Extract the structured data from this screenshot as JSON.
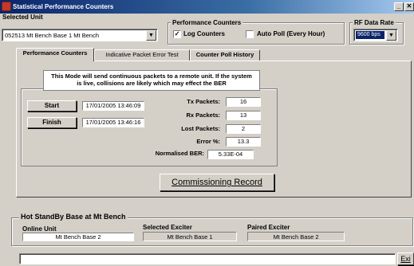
{
  "window": {
    "title": "Statistical Performance Counters",
    "minimize_glyph": "_",
    "close_glyph": "✕"
  },
  "selected_unit": {
    "label": "Selected Unit",
    "value": "052513 Mt Bench Base 1 Mt Bench",
    "arrow": "▼"
  },
  "performance_counters": {
    "label": "Performance Counters",
    "log_counters": {
      "label": "Log Counters",
      "checked": true,
      "mark": "✓"
    },
    "auto_poll": {
      "label": "Auto Poll  (Every Hour)",
      "checked": false,
      "mark": ""
    }
  },
  "rf_data_rate": {
    "label": "RF Data Rate",
    "value": "9600 bps",
    "arrow": "▼"
  },
  "tabs": [
    {
      "label": "Performance Counters",
      "active": true
    },
    {
      "label": "Indicative Packet Error Test",
      "active": false
    },
    {
      "label": "Counter Poll History",
      "active": false
    }
  ],
  "warning_text": "This Mode will send continuous packets to a remote unit. If the system is live, collisions are likely which may effect the BER",
  "start": {
    "label": "Start",
    "time": "17/01/2005  13:46:09"
  },
  "finish": {
    "label": "Finish",
    "time": "17/01/2005  13:46:16"
  },
  "stats": {
    "tx": {
      "label": "Tx Packets:",
      "value": "16"
    },
    "rx": {
      "label": "Rx Packets:",
      "value": "13"
    },
    "lost": {
      "label": "Lost Packets:",
      "value": "2"
    },
    "error": {
      "label": "Error %:",
      "value": "13.3"
    },
    "ber": {
      "label": "Normalised BER:",
      "value": "5.33E-04"
    }
  },
  "commissioning_button": "Commissioning Record",
  "hot_standby": {
    "title": "Hot StandBy Base at Mt Bench",
    "online_unit": {
      "label": "Online Unit",
      "value": "Mt Bench Base 2"
    },
    "selected_exciter": {
      "label": "Selected Exciter",
      "value": "Mt Bench Base 1"
    },
    "paired_exciter": {
      "label": "Paired Exciter",
      "value": "Mt Bench Base 2"
    }
  },
  "status_bar": {
    "text": ""
  },
  "exit_button": "Exi"
}
